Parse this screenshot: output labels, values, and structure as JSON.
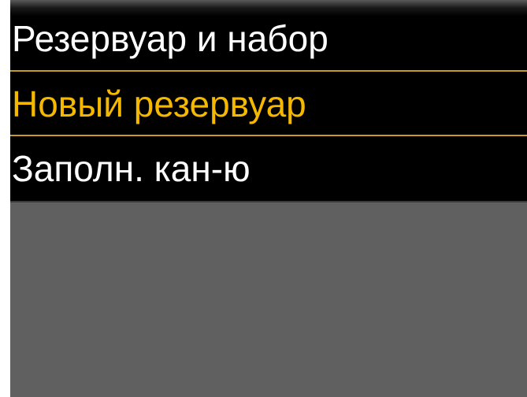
{
  "header": {
    "title": "Резервуар и набор"
  },
  "menu": {
    "items": [
      {
        "label": "Новый резервуар",
        "selected": true
      },
      {
        "label": "Заполн. кан-ю",
        "selected": false
      }
    ]
  },
  "colors": {
    "selected_text": "#f5b800",
    "selected_border": "#c89b1a",
    "normal_text": "#ffffff",
    "row_background": "#000000",
    "screen_background": "#606060"
  }
}
